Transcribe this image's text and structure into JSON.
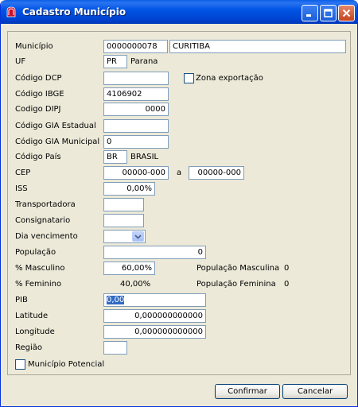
{
  "window": {
    "title": "Cadastro Município"
  },
  "form": {
    "municipio": {
      "label": "Município",
      "code": "0000000078",
      "name": "CURITIBA"
    },
    "uf": {
      "label": "UF",
      "code": "PR",
      "name": "Parana"
    },
    "codigo_dcp": {
      "label": "Código DCP",
      "value": ""
    },
    "zona_exportacao": {
      "label": "Zona exportação",
      "checked": false
    },
    "codigo_ibge": {
      "label": "Código IBGE",
      "value": "4106902"
    },
    "codigo_dipj": {
      "label": "Codigo DIPJ",
      "value": "0000"
    },
    "codigo_gia_estadual": {
      "label": "Código GIA Estadual",
      "value": ""
    },
    "codigo_gia_municipal": {
      "label": "Código GIA Municipal",
      "value": "0"
    },
    "codigo_pais": {
      "label": "Código País",
      "code": "BR",
      "name": "BRASIL"
    },
    "cep": {
      "label": "CEP",
      "from": "00000-000",
      "separator": "a",
      "to": "00000-000"
    },
    "iss": {
      "label": "ISS",
      "value": "0,00%"
    },
    "transportadora": {
      "label": "Transportadora",
      "value": ""
    },
    "consignatario": {
      "label": "Consignatario",
      "value": ""
    },
    "dia_vencimento": {
      "label": "Dia vencimento",
      "value": ""
    },
    "populacao": {
      "label": "População",
      "value": "0"
    },
    "pct_masculino": {
      "label": "% Masculino",
      "value": "60,00%"
    },
    "populacao_masculina": {
      "label": "População Masculina",
      "value": "0"
    },
    "pct_feminino": {
      "label": "% Feminino",
      "value": "40,00%"
    },
    "populacao_feminina": {
      "label": "População Feminina",
      "value": "0"
    },
    "pib": {
      "label": "PIB",
      "value": "0,00"
    },
    "latitude": {
      "label": "Latitude",
      "value": "0,000000000000"
    },
    "longitude": {
      "label": "Longitude",
      "value": "0,000000000000"
    },
    "regiao": {
      "label": "Região",
      "value": ""
    },
    "municipio_potencial": {
      "label": "Município Potencial",
      "checked": false
    }
  },
  "buttons": {
    "confirm_label": "Confirmar",
    "cancel_label": "Cancelar"
  }
}
